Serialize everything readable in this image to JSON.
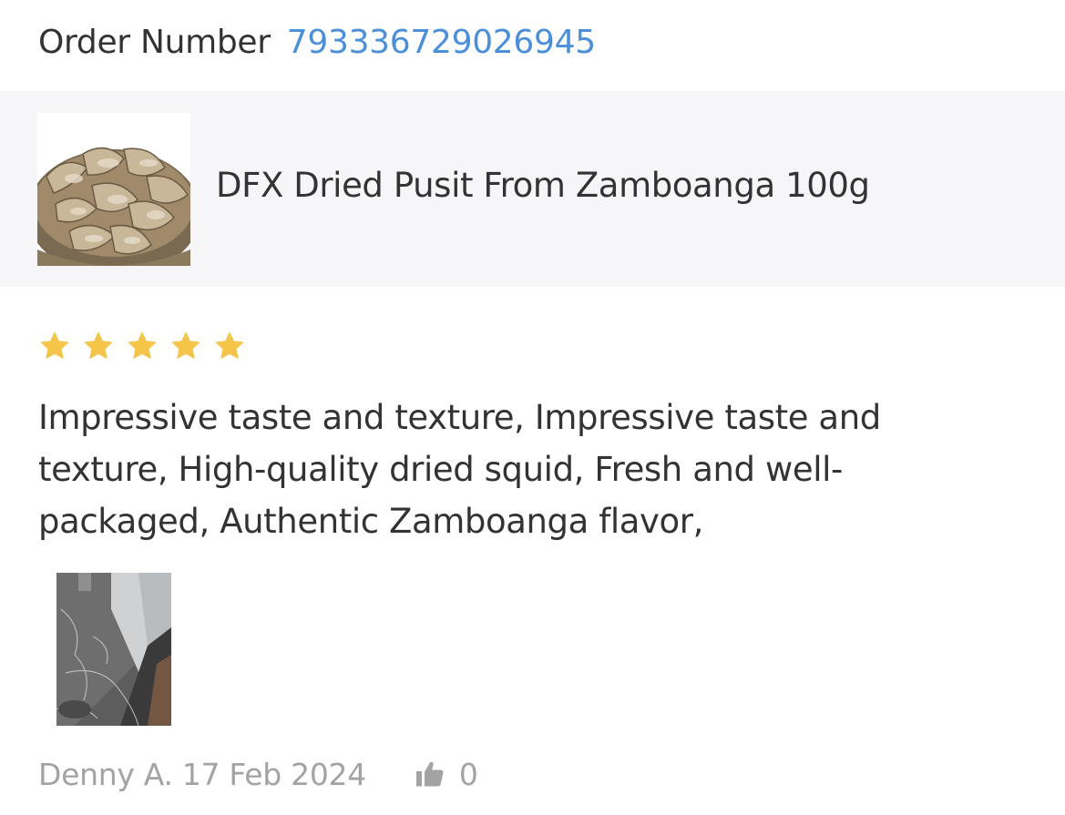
{
  "order": {
    "label": "Order Number",
    "number": "793336729026945"
  },
  "product": {
    "name": "DFX Dried Pusit From Zamboanga 100g",
    "thumbnail_icon": "dried-squid-photo"
  },
  "review": {
    "rating": 5,
    "rating_max": 5,
    "star_color": "#f5c54a",
    "text": "Impressive taste and texture, Impressive taste and texture, High-quality dried squid, Fresh and well-packaged, Authentic Zamboanga flavor,",
    "photo_icon": "review-photo-floor"
  },
  "footer": {
    "reviewer": "Denny A.",
    "date": "17 Feb 2024",
    "reviewer_line": "Denny A. 17 Feb 2024",
    "like_icon": "thumbs-up-icon",
    "like_count": "0"
  },
  "colors": {
    "accent": "#4a8fd8",
    "muted": "#a3a3a3",
    "panel": "#f6f6f8"
  }
}
